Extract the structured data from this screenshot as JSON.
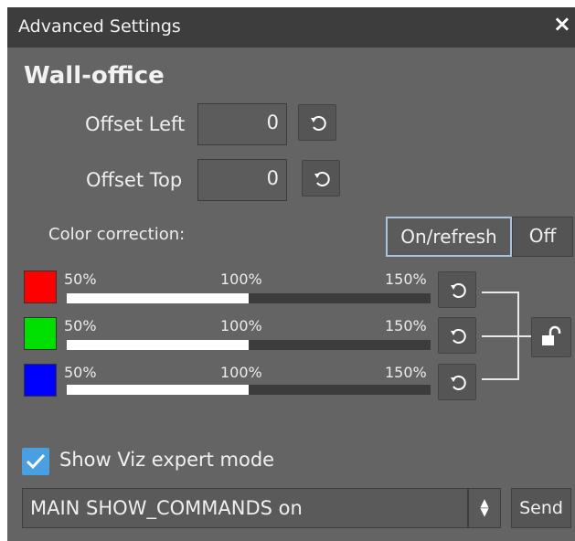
{
  "window": {
    "title": "Advanced Settings",
    "close": "×"
  },
  "section": {
    "title": "Wall-office"
  },
  "offsets": {
    "left_label": "Offset Left",
    "left_value": "0",
    "top_label": "Offset Top",
    "top_value": "0"
  },
  "color_correction": {
    "label": "Color correction:",
    "on_label": "On/refresh",
    "off_label": "Off",
    "on_active": true,
    "scale": {
      "min": "50%",
      "mid": "100%",
      "max": "150%"
    },
    "channels": [
      {
        "name": "red",
        "color": "#ff0000",
        "fraction": 0.5
      },
      {
        "name": "green",
        "color": "#00e000",
        "fraction": 0.5
      },
      {
        "name": "blue",
        "color": "#0000ff",
        "fraction": 0.5
      }
    ],
    "locked": false
  },
  "expert_mode": {
    "label": "Show Viz expert mode",
    "checked": true
  },
  "command": {
    "value": "MAIN SHOW_COMMANDS on",
    "send_label": "Send"
  },
  "icons": {
    "close": "close-icon",
    "reset": "reset-icon",
    "lock": "unlock-icon",
    "check": "checkmark-icon",
    "spinner": "up-down-arrows-icon"
  },
  "colors": {
    "accent": "#4a9fe0",
    "panel": "#646464",
    "titlebar": "#3d3d3d"
  }
}
